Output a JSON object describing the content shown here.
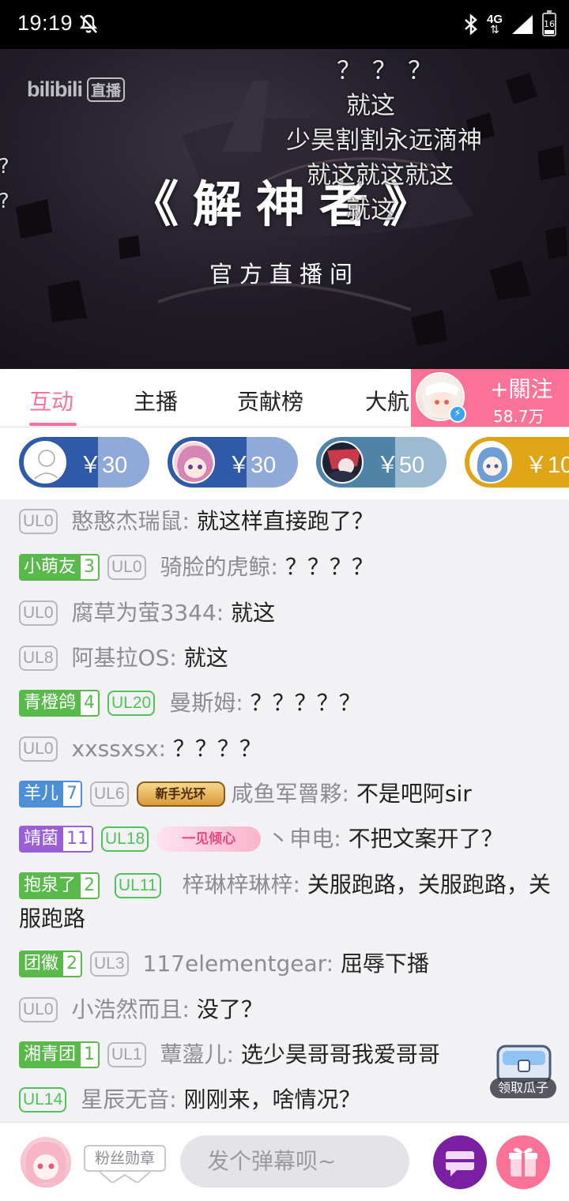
{
  "status_bar": {
    "time": "19:19",
    "network": "4G",
    "battery": "16"
  },
  "video": {
    "logo_text": "bilibili",
    "logo_badge": "直播",
    "title": "《解神者》",
    "subtitle": "官方直播间",
    "danmaku": [
      "？？？",
      "就这",
      "少昊割割永远滴神",
      "就这就这就这",
      "就这"
    ],
    "edge_marks": [
      "?",
      "?"
    ]
  },
  "tabs": {
    "items": [
      {
        "label": "互动"
      },
      {
        "label": "主播"
      },
      {
        "label": "贡献榜"
      },
      {
        "label": "大航"
      }
    ]
  },
  "follow": {
    "label": "+關注",
    "count": "58.7万"
  },
  "gift_pills": [
    {
      "amount": "￥30",
      "color_left": "#2e5aa8",
      "color_right": "#8fa9d8"
    },
    {
      "amount": "￥30",
      "color_left": "#2e5aa8",
      "color_right": "#8fa9d8"
    },
    {
      "amount": "￥50",
      "color_left": "#4f83a8",
      "color_right": "#9dbbd0"
    },
    {
      "amount": "￥10",
      "color_left": "#e0a516",
      "color_right": "#e0a516"
    }
  ],
  "chat": {
    "messages": [
      {
        "medal": null,
        "ul": "UL0",
        "ul_style": "gray",
        "user": "憨憨杰瑞鼠:",
        "text": "就这样直接跑了？"
      },
      {
        "medal": {
          "name": "小萌友",
          "level": "3",
          "color": "#59b94b"
        },
        "ul": "UL0",
        "ul_style": "gray",
        "user": "骑脸的虎鲸:",
        "text": "？？？？"
      },
      {
        "medal": null,
        "ul": "UL0",
        "ul_style": "gray",
        "user": "腐草为萤3344:",
        "text": "就这"
      },
      {
        "medal": null,
        "ul": "UL8",
        "ul_style": "gray",
        "user": "阿基拉OS:",
        "text": "就这"
      },
      {
        "medal": {
          "name": "青橙鸽",
          "level": "4",
          "color": "#59b94b"
        },
        "ul": "UL20",
        "ul_style": "green",
        "user": "曼斯姆:",
        "text": "？？？？？"
      },
      {
        "medal": null,
        "ul": "UL0",
        "ul_style": "gray",
        "user": "xxssxsx:",
        "text": "？？？？"
      },
      {
        "medal": {
          "name": "羊儿",
          "level": "7",
          "color": "#4c8fd6"
        },
        "ul": "UL6",
        "ul_style": "gray",
        "title_badge": "新手光环",
        "user": "咸鱼军罾夥:",
        "text": "不是吧阿sir"
      },
      {
        "medal": {
          "name": "靖菌",
          "level": "11",
          "color": "#9a5fd6"
        },
        "ul": "UL18",
        "ul_style": "green",
        "title_badge": "一见倾心",
        "user": "丶申电:",
        "text": "不把文案开了？"
      },
      {
        "medal": {
          "name": "抱泉了",
          "level": "2",
          "color": "#59b94b"
        },
        "ul": "UL11",
        "ul_style": "green",
        "user": "梓琳梓琳梓:",
        "text": "关服跑路，关服跑路，关服跑路"
      },
      {
        "medal": {
          "name": "团徽",
          "level": "2",
          "color": "#59b94b"
        },
        "ul": "UL3",
        "ul_style": "gray",
        "user": "117elementgear:",
        "text": "屈辱下播"
      },
      {
        "medal": null,
        "ul": "UL0",
        "ul_style": "gray",
        "user": "小浩然而且:",
        "text": "没了？"
      },
      {
        "medal": {
          "name": "湘青团",
          "level": "1",
          "color": "#59b94b"
        },
        "ul": "UL1",
        "ul_style": "gray",
        "user": "蕈蘯儿:",
        "text": "选少昊哥哥我爱哥哥"
      },
      {
        "medal": null,
        "ul": "UL14",
        "ul_style": "green",
        "user": "星辰无音:",
        "text": "刚刚来，啥情况？"
      }
    ],
    "chest_label": "领取瓜子"
  },
  "bottom_bar": {
    "fan_medal_label": "粉丝勋章",
    "input_placeholder": "发个弹幕呗~"
  },
  "colors": {
    "accent": "#fb7299",
    "tab_active": "#fb7299",
    "danmaku_button": "#7b1fa2",
    "gift_button": "#fb7299"
  }
}
